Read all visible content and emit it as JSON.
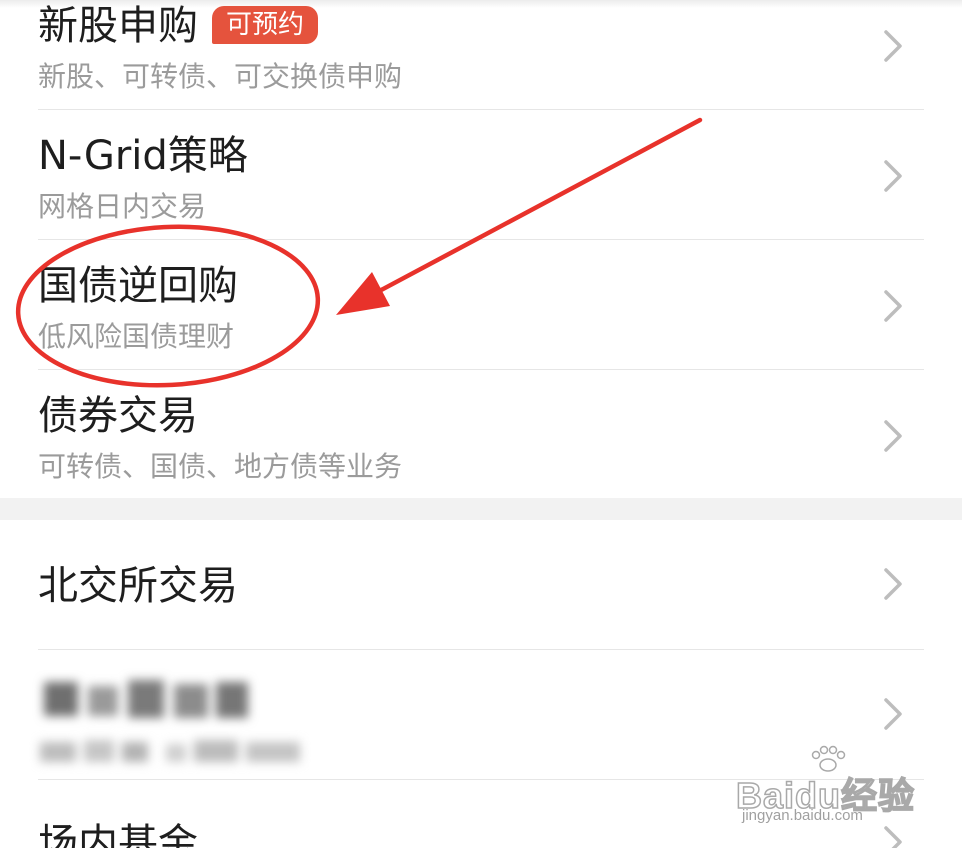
{
  "menu_group_1": [
    {
      "title": "新股申购",
      "subtitle": "新股、可转债、可交换债申购",
      "badge": "可预约"
    },
    {
      "title": "N-Grid策略",
      "subtitle": "网格日内交易"
    },
    {
      "title": "国债逆回购",
      "subtitle": "低风险国债理财"
    },
    {
      "title": "债券交易",
      "subtitle": "可转债、国债、地方债等业务"
    }
  ],
  "menu_group_2": [
    {
      "title": "北交所交易"
    },
    {
      "title": "",
      "subtitle": "",
      "blurred": true
    },
    {
      "title": "场内基金"
    }
  ],
  "annotation": {
    "highlight_target": "国债逆回购",
    "color": "#e8322b"
  },
  "watermark": {
    "text": "Baidu经验",
    "url_text": "jingyan.baidu.com"
  },
  "colors": {
    "badge": "#e5533d",
    "title": "#1e1e1e",
    "subtitle": "#9b9b9b",
    "divider": "#e6e6e6",
    "section_gap": "#f2f2f2"
  }
}
